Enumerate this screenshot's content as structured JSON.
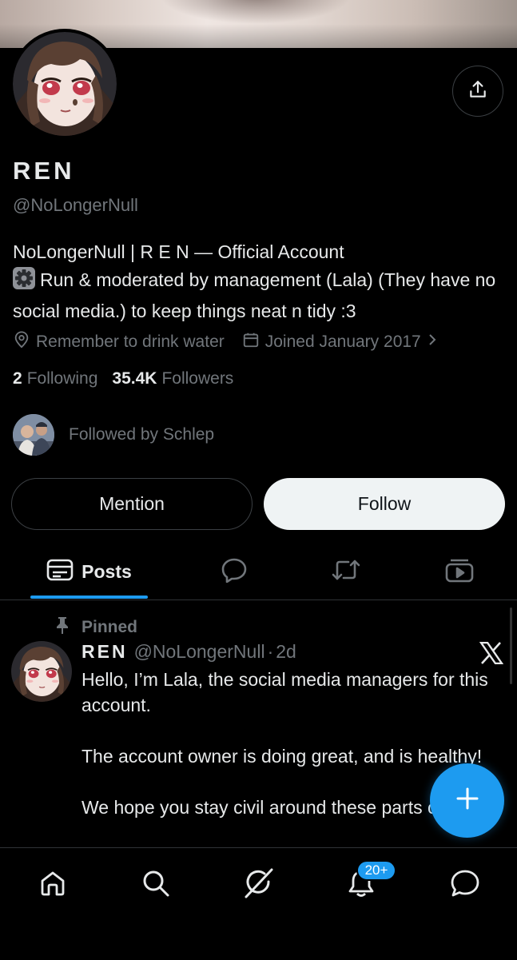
{
  "profile": {
    "display_name": "REN",
    "handle": "@NoLongerNull",
    "bio_line1": "NoLongerNull | R E N — Official Account",
    "bio_line2": "Run & moderated by management (Lala) (They have no social media.) to keep things neat n tidy :3",
    "location": "Remember to drink water",
    "joined": "Joined January 2017",
    "following_count": "2",
    "following_label": "Following",
    "followers_count": "35.4K",
    "followers_label": "Followers",
    "followed_by": "Followed by Schlep"
  },
  "actions": {
    "mention_label": "Mention",
    "follow_label": "Follow"
  },
  "tabs": {
    "posts_label": "Posts"
  },
  "pinned_post": {
    "pinned_label": "Pinned",
    "author_name": "REN",
    "author_handle": "@NoLongerNull",
    "separator": "·",
    "age": "2d",
    "text": "Hello, I’m Lala, the social media managers for this account.\n\nThe account owner is doing great, and is healthy!\n\nWe hope you stay civil around these parts of"
  },
  "nav": {
    "notifications_badge": "20+"
  },
  "icons": {
    "share": "share-icon",
    "location": "location-pin-icon",
    "calendar": "calendar-icon",
    "posts_tab": "posts-icon",
    "replies_tab": "reply-bubble-icon",
    "reposts_tab": "repost-icon",
    "media_tab": "media-icon",
    "pin": "pin-icon",
    "x_logo": "x-logo-icon",
    "compose": "plus-icon",
    "home": "home-icon",
    "search": "search-icon",
    "grok": "grok-icon",
    "notifications": "bell-icon",
    "messages": "messages-icon"
  },
  "colors": {
    "background": "#000000",
    "text_primary": "#e7e9ea",
    "text_secondary": "#71767b",
    "accent": "#1d9bf0",
    "border": "#2f3336",
    "follow_button_bg": "#eff3f4"
  }
}
